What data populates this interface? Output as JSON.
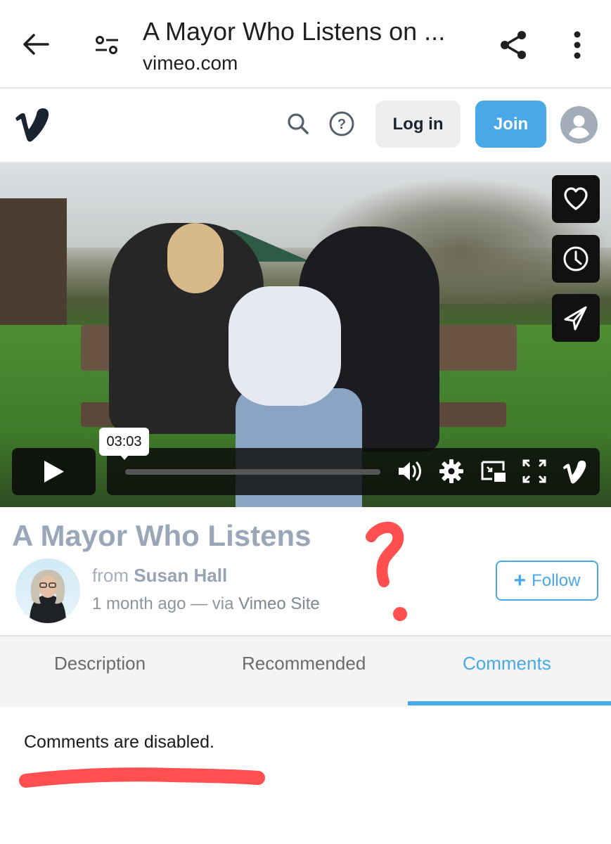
{
  "browser": {
    "page_title": "A Mayor Who Listens on ...",
    "domain": "vimeo.com",
    "icons": [
      "back-arrow-icon",
      "site-settings-icon",
      "share-icon",
      "more-vert-icon"
    ]
  },
  "header": {
    "logo": "vimeo-logo",
    "login_label": "Log in",
    "join_label": "Join",
    "icons": [
      "search-icon",
      "help-icon",
      "user-avatar-icon"
    ]
  },
  "player": {
    "time_tooltip": "03:03",
    "progress": 0,
    "side_actions": [
      "like",
      "watch-later",
      "share"
    ],
    "controls": [
      "play",
      "volume",
      "settings",
      "picture-in-picture",
      "fullscreen",
      "vimeo"
    ]
  },
  "video": {
    "title": "A Mayor Who Listens",
    "from_label": "from",
    "owner": "Susan Hall",
    "age": "1 month ago",
    "via_prefix": "— via",
    "via": "Vimeo Site",
    "follow_label": "Follow",
    "follow_icon": "+"
  },
  "tabs": [
    {
      "label": "Description",
      "active": false
    },
    {
      "label": "Recommended",
      "active": false
    },
    {
      "label": "Comments",
      "active": true
    }
  ],
  "comments": {
    "message": "Comments are disabled."
  },
  "annotations": {
    "mark": "?",
    "color": "#ff4f4f"
  },
  "colors": {
    "accent": "#4aa8e8",
    "title_gray": "#9aa7b8",
    "annotation_red": "#ff4f4f"
  }
}
